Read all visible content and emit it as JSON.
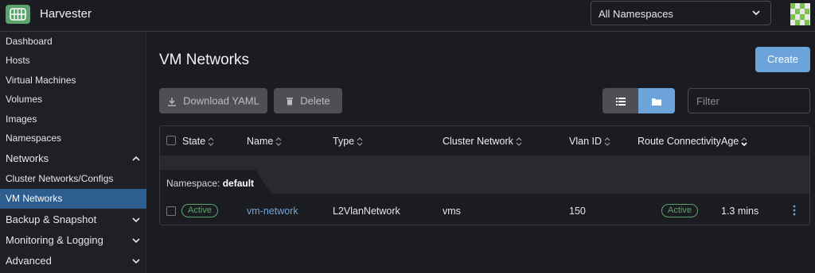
{
  "app": {
    "title": "Harvester"
  },
  "header": {
    "namespace_select": "All Namespaces"
  },
  "sidebar": {
    "items": [
      {
        "label": "Dashboard"
      },
      {
        "label": "Hosts"
      },
      {
        "label": "Virtual Machines"
      },
      {
        "label": "Volumes"
      },
      {
        "label": "Images"
      },
      {
        "label": "Namespaces"
      },
      {
        "label": "Networks"
      },
      {
        "label": "Cluster Networks/Configs"
      },
      {
        "label": "VM Networks"
      },
      {
        "label": "Backup & Snapshot"
      },
      {
        "label": "Monitoring & Logging"
      },
      {
        "label": "Advanced"
      }
    ],
    "active": "VM Networks"
  },
  "main": {
    "title": "VM Networks",
    "create_label": "Create",
    "download_label": "Download YAML",
    "delete_label": "Delete",
    "filter_placeholder": "Filter",
    "icons": {
      "download": "download-icon",
      "delete": "trash-icon",
      "list_view": "list-icon",
      "folder_view": "folder-icon"
    }
  },
  "table": {
    "columns": [
      "State",
      "Name",
      "Type",
      "Cluster Network",
      "Vlan ID",
      "Route Connectivity",
      "Age"
    ],
    "group": {
      "prefix": "Namespace:",
      "name": "default"
    },
    "rows": [
      {
        "state": "Active",
        "name": "vm-network",
        "type": "L2VlanNetwork",
        "cluster_network": "vms",
        "vlan_id": "150",
        "route_connectivity": "Active",
        "age": "1.3 mins"
      }
    ]
  },
  "colors": {
    "accent": "#6ca4d9",
    "active_nav": "#2d5e8e",
    "status_active": "#5aa46b",
    "background": "#1b1c21"
  }
}
